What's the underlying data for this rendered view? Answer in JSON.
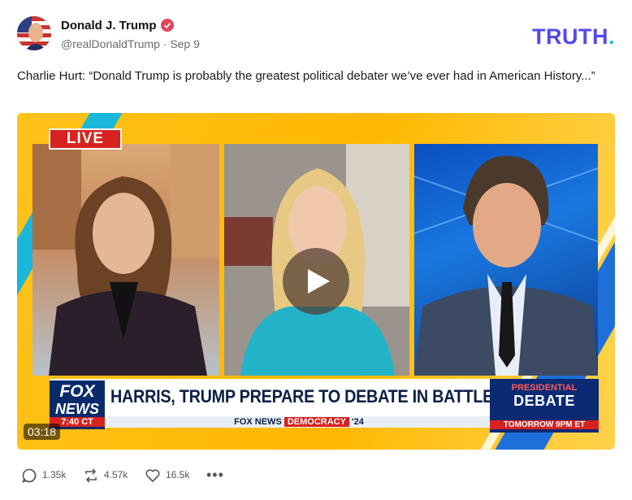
{
  "author": {
    "name": "Donald J. Trump",
    "handle": "@realDonaldTrump",
    "separator": "·",
    "date": "Sep 9"
  },
  "brand": {
    "logo": "TRUTH",
    "dot": "."
  },
  "post": {
    "text": "Charlie Hurt: “Donald Trump is probably the greatest political debater we’ve ever had in American History...”"
  },
  "video": {
    "live_label": "LIVE",
    "headline": "HARRIS, TRUMP PREPARE TO DEBATE IN BATTLEGROUND PA",
    "network_top": "FOX",
    "network_bottom": "NEWS",
    "clock": "7:40 CT",
    "subticker_brand": "FOX NEWS",
    "subticker_segment": "DEMOCRACY",
    "subticker_year": "'24",
    "promo_line1": "PRESIDENTIAL",
    "promo_line2": "DEBATE",
    "promo_line3": "TOMORROW 9PM ET",
    "duration": "03:18"
  },
  "actions": {
    "replies": "1.35k",
    "retruths": "4.57k",
    "likes": "16.5k",
    "more": "•••"
  },
  "colors": {
    "brand_purple": "#5448ee",
    "brand_cyan": "#27c5d8",
    "verified": "#e0445a",
    "fox_blue": "#0a2b6b",
    "fox_red": "#d7231f"
  }
}
